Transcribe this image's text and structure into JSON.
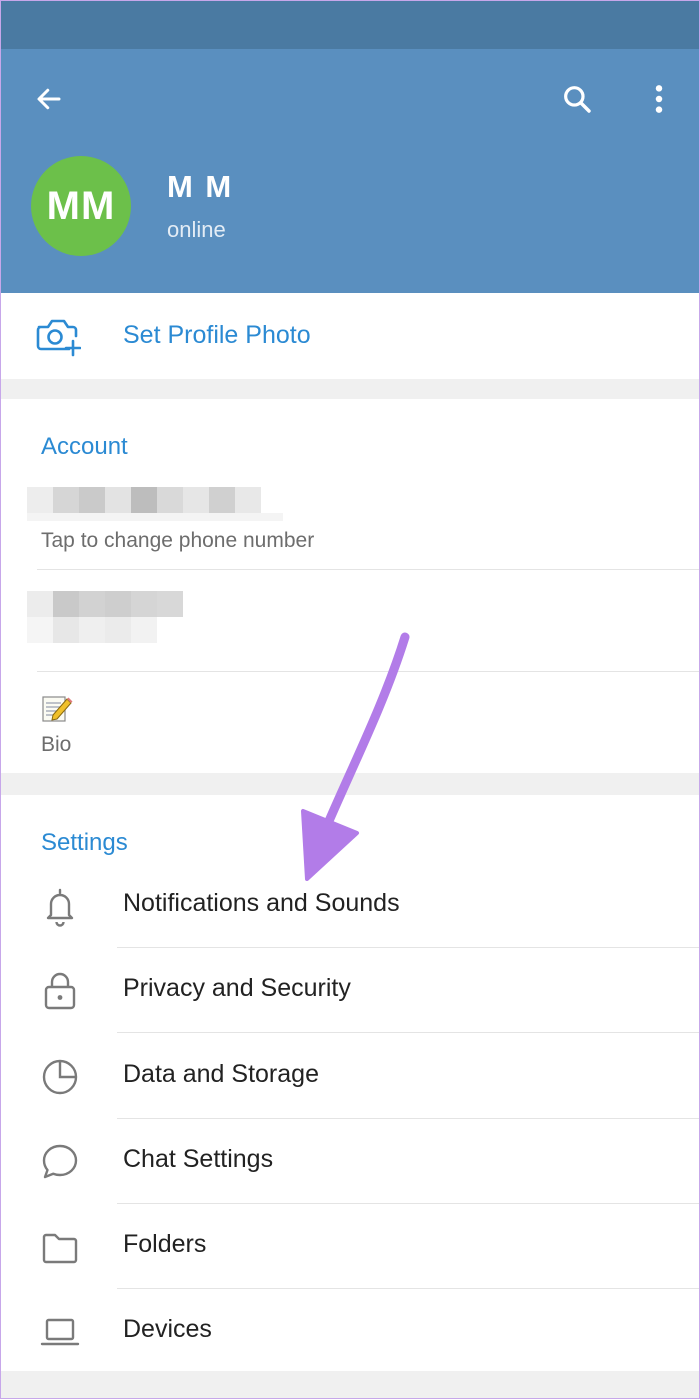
{
  "profile": {
    "name": "M M",
    "status": "online",
    "avatar_initials": "MM",
    "avatar_color": "#6cc04a"
  },
  "toolbar": {
    "back_icon": "arrow-left-icon",
    "search_icon": "search-icon",
    "more_icon": "more-vertical-icon"
  },
  "photo": {
    "label": "Set Profile Photo",
    "icon": "camera-add-icon"
  },
  "account": {
    "title": "Account",
    "phone_hint": "Tap to change phone number",
    "bio_label": "Bio"
  },
  "settings": {
    "title": "Settings",
    "items": [
      {
        "label": "Notifications and Sounds",
        "icon": "bell-icon"
      },
      {
        "label": "Privacy and Security",
        "icon": "lock-icon"
      },
      {
        "label": "Data and Storage",
        "icon": "pie-chart-icon"
      },
      {
        "label": "Chat Settings",
        "icon": "chat-bubble-icon"
      },
      {
        "label": "Folders",
        "icon": "folder-icon"
      },
      {
        "label": "Devices",
        "icon": "laptop-icon"
      }
    ]
  },
  "colors": {
    "header": "#5a8fbf",
    "statusbar": "#4a7aa2",
    "accent": "#2b8ad3",
    "annotation_arrow": "#b27ce8"
  }
}
